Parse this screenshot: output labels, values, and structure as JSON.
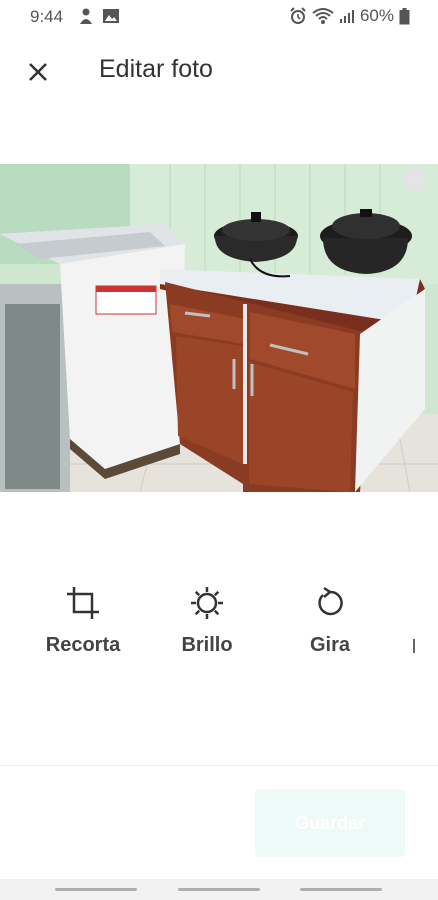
{
  "status_bar": {
    "time": "9:44",
    "battery": "60%",
    "left_icons": [
      "notification-icon",
      "gallery-icon"
    ],
    "right_icons": [
      "alarm-icon",
      "wifi-icon",
      "signal-icon",
      "battery-icon"
    ]
  },
  "header": {
    "close_icon": "close-icon",
    "title": "Editar foto"
  },
  "photo": {
    "subject": "kitchen-photo"
  },
  "tools": [
    {
      "label": "Recorta",
      "icon": "crop-icon"
    },
    {
      "label": "Brillo",
      "icon": "brightness-icon"
    },
    {
      "label": "Gira",
      "icon": "rotate-icon"
    }
  ],
  "footer": {
    "save_label": "Guardar",
    "save_bg": "#eefaf8",
    "save_text_color": "#ffffff"
  }
}
